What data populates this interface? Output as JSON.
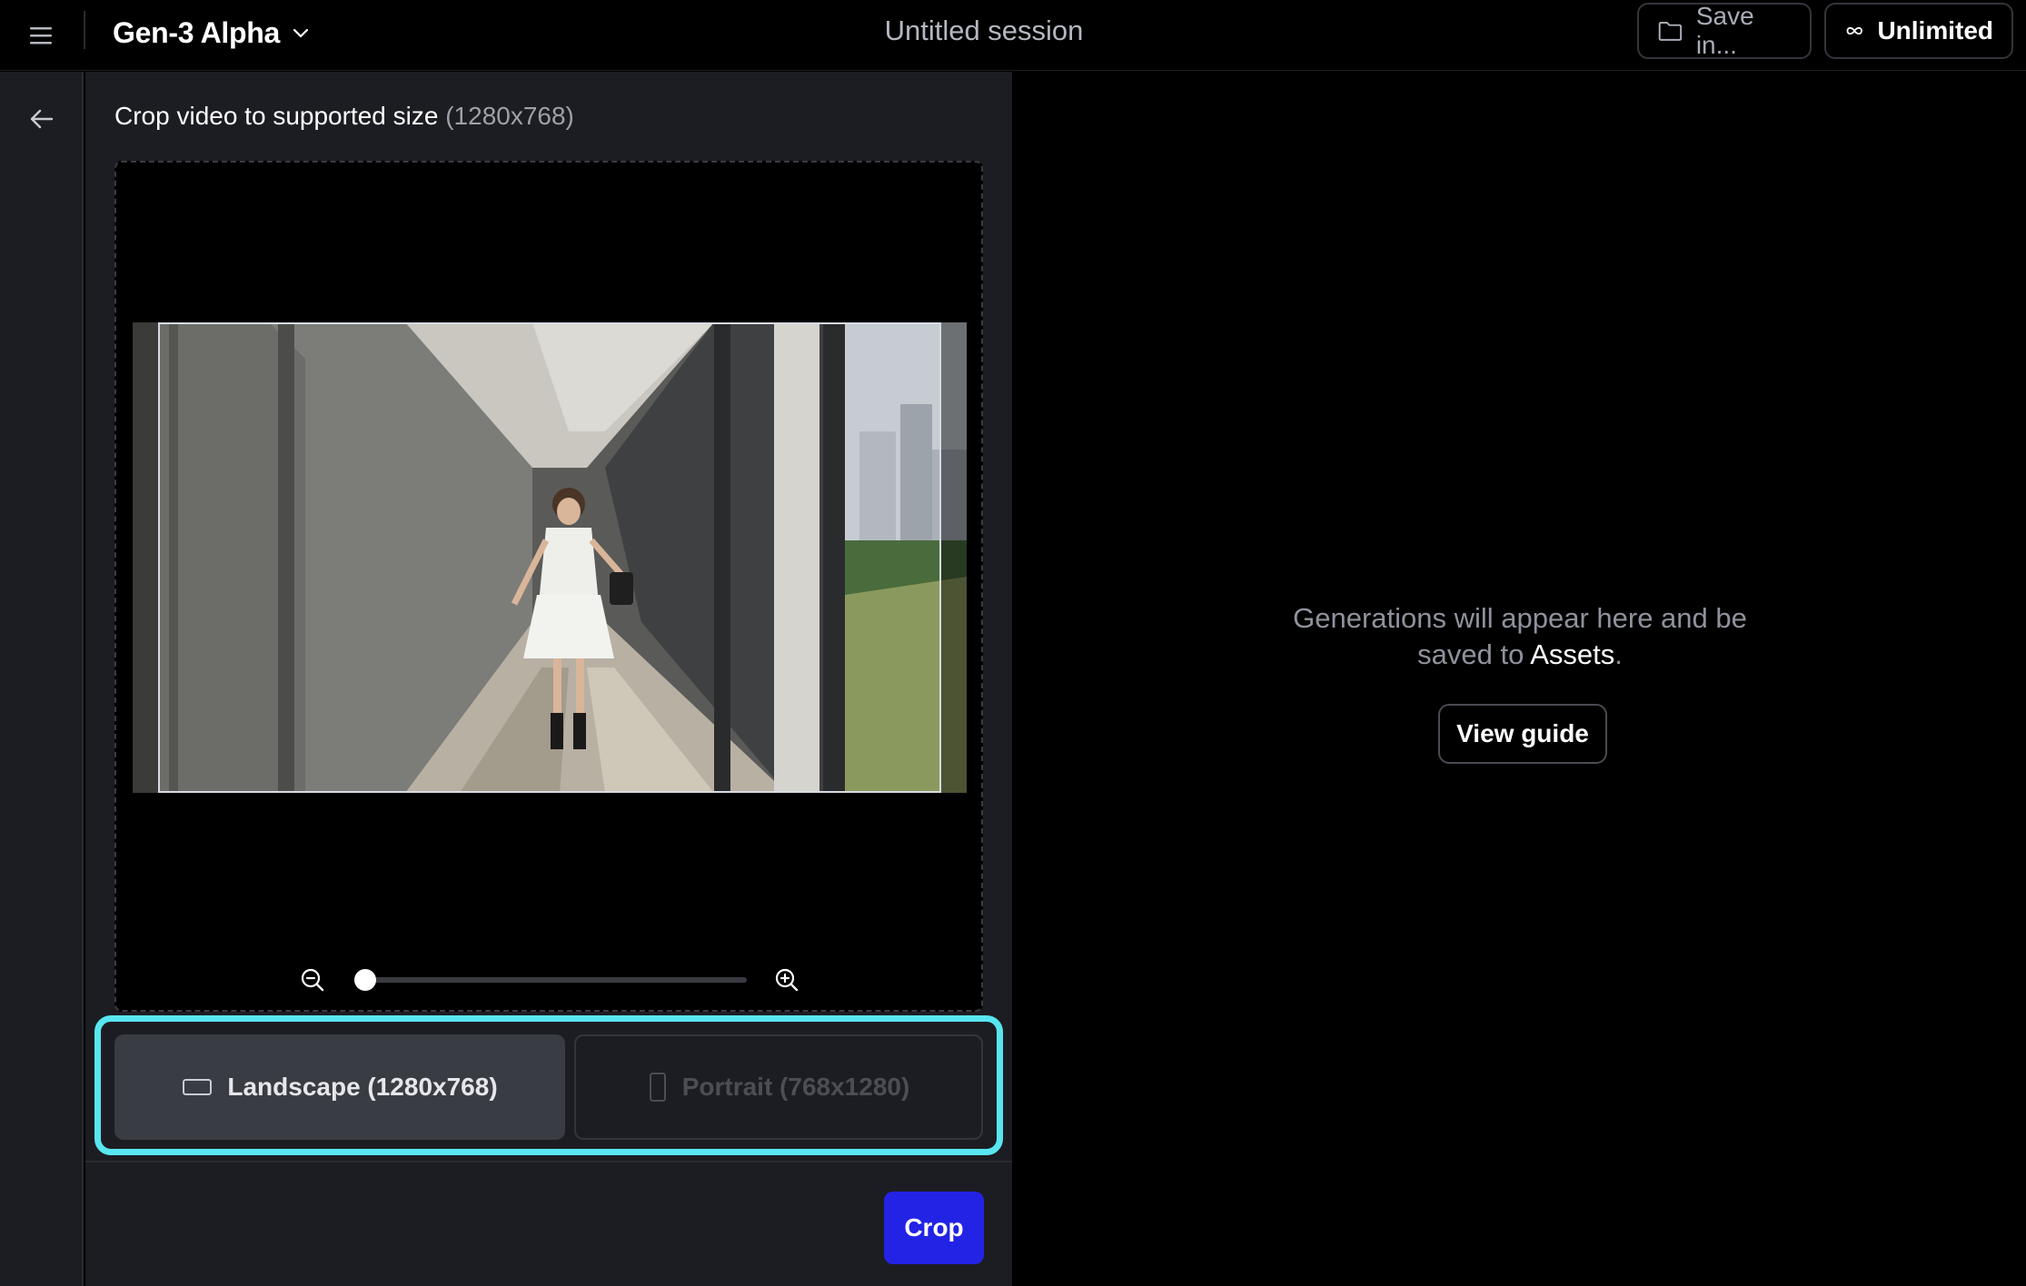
{
  "header": {
    "model_name": "Gen-3 Alpha",
    "session_title": "Untitled session",
    "save_label": "Save in...",
    "plan_label": "Unlimited"
  },
  "crop_panel": {
    "title": "Crop video to supported size",
    "title_dims": "(1280x768)",
    "zoom": {
      "level": 0.0
    },
    "orientations": [
      {
        "label": "Landscape (1280x768)",
        "selected": true,
        "enabled": true
      },
      {
        "label": "Portrait (768x1280)",
        "selected": false,
        "enabled": false
      }
    ],
    "crop_label": "Crop"
  },
  "empty_state": {
    "line1": "Generations will appear here and be",
    "line2_prefix": "saved to ",
    "line2_link": "Assets",
    "line2_suffix": ".",
    "guide_label": "View guide"
  },
  "icons": {
    "menu": "hamburger-icon",
    "model_dropdown": "chevron-down-icon",
    "save": "folder-icon",
    "plan": "infinity-icon",
    "back": "arrow-left-icon",
    "zoom_out": "zoom-out-icon",
    "zoom_in": "zoom-in-icon",
    "landscape": "landscape-rect-icon",
    "portrait": "portrait-rect-icon"
  },
  "colors": {
    "accent_primary": "#2323e6",
    "highlight": "#58e6f0",
    "panel_bg": "#1c1d22",
    "page_bg": "#000000"
  }
}
